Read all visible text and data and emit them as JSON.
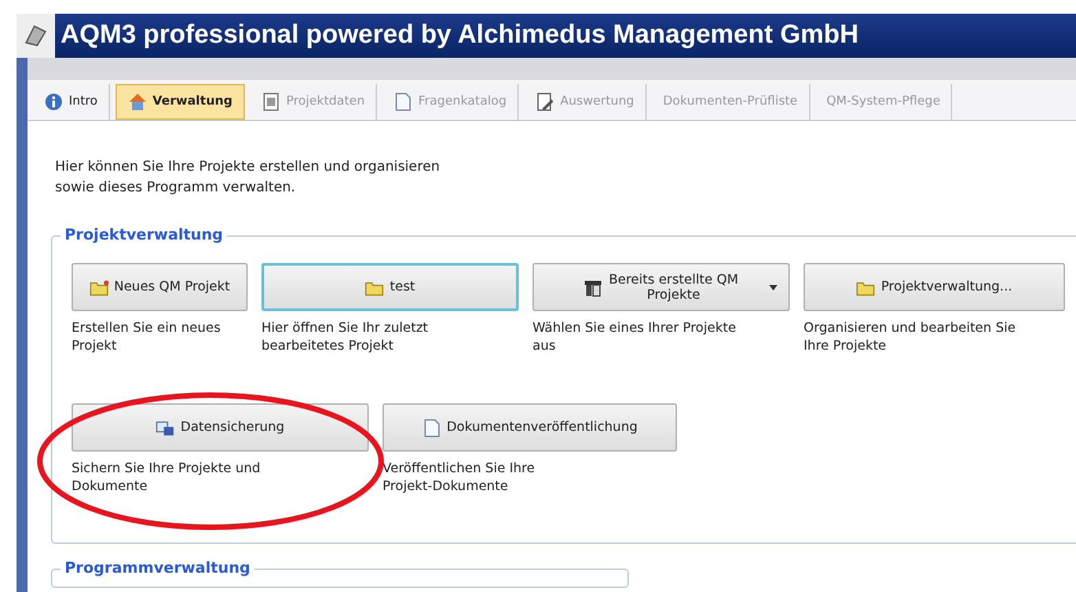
{
  "window": {
    "title": "AQM3 professional powered by Alchimedus Management GmbH"
  },
  "tabs": [
    {
      "label": "Intro",
      "selected": false,
      "disabled": false
    },
    {
      "label": "Verwaltung",
      "selected": true,
      "disabled": false
    },
    {
      "label": "Projektdaten",
      "selected": false,
      "disabled": true
    },
    {
      "label": "Fragenkatalog",
      "selected": false,
      "disabled": true
    },
    {
      "label": "Auswertung",
      "selected": false,
      "disabled": true
    },
    {
      "label": "Dokumenten-Prüfliste",
      "selected": false,
      "disabled": true
    },
    {
      "label": "QM-System-Pflege",
      "selected": false,
      "disabled": true
    }
  ],
  "intro": "Hier können Sie Ihre Projekte erstellen und organisieren\nsowie dieses Programm verwalten.",
  "groups": [
    {
      "title": "Projektverwaltung",
      "rows": [
        [
          {
            "label": "Neues QM Projekt",
            "kind": "plain",
            "focused": false,
            "description": "Erstellen Sie ein neues\nProjekt"
          },
          {
            "label": "test",
            "kind": "plain",
            "focused": true,
            "description": "Hier öffnen Sie Ihr zuletzt\nbearbeitetes Projekt"
          },
          {
            "label": "Bereits erstellte QM\nProjekte",
            "kind": "dropdown",
            "focused": false,
            "description": "Wählen Sie eines Ihrer Projekte\naus"
          },
          {
            "label": "Projektverwaltung...",
            "kind": "plain",
            "focused": false,
            "description": "Organisieren und bearbeiten Sie\nIhre Projekte"
          }
        ],
        [
          {
            "label": "Datensicherung",
            "kind": "plain",
            "focused": false,
            "description": "Sichern Sie Ihre Projekte und\nDokumente"
          },
          {
            "label": "Dokumentenveröffentlichung",
            "kind": "plain",
            "focused": false,
            "description": "Veröffentlichen Sie Ihre\nProjekt-Dokumente"
          }
        ]
      ]
    },
    {
      "title": "Programmverwaltung"
    }
  ]
}
